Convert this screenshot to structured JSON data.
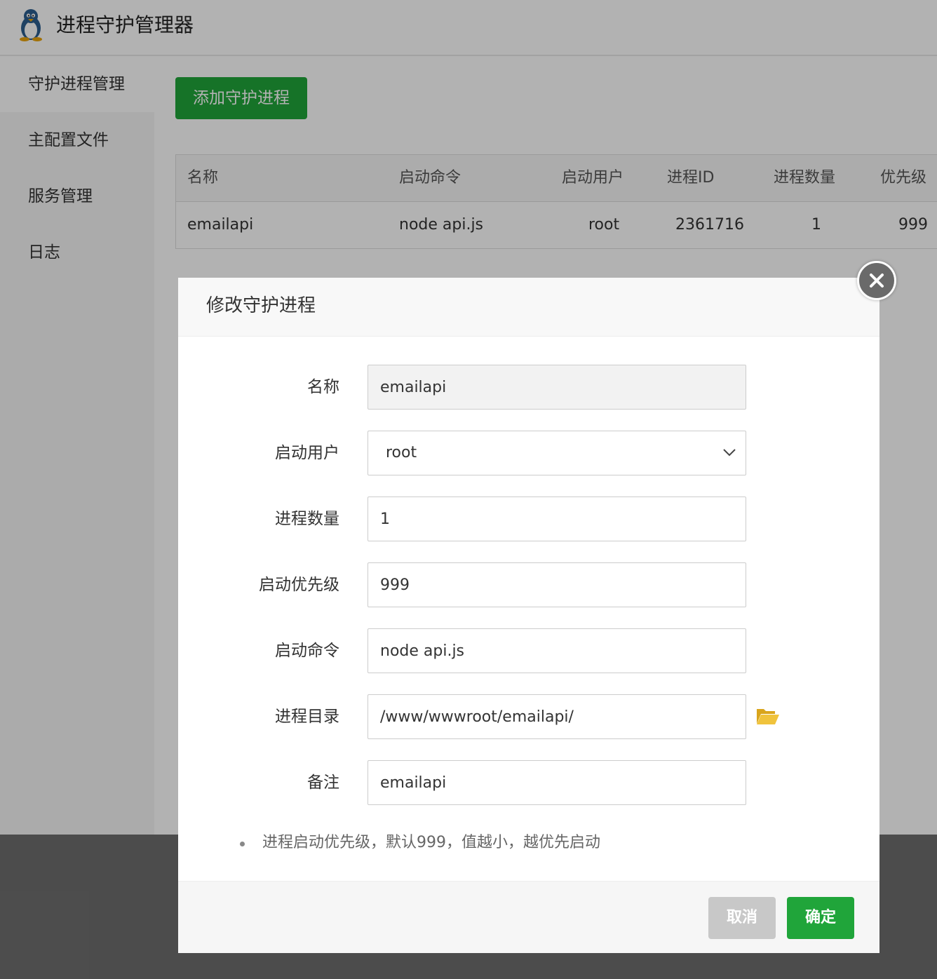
{
  "app": {
    "title": "进程守护管理器"
  },
  "sidebar": {
    "items": [
      {
        "label": "守护进程管理",
        "active": true
      },
      {
        "label": "主配置文件"
      },
      {
        "label": "服务管理"
      },
      {
        "label": "日志"
      }
    ]
  },
  "main": {
    "add_button": "添加守护进程",
    "table": {
      "headers": [
        "名称",
        "启动命令",
        "启动用户",
        "进程ID",
        "进程数量",
        "优先级"
      ],
      "rows": [
        [
          "emailapi",
          "node api.js",
          "root",
          "2361716",
          "1",
          "999"
        ]
      ]
    }
  },
  "modal": {
    "title": "修改守护进程",
    "fields": {
      "name": {
        "label": "名称",
        "value": "emailapi"
      },
      "user": {
        "label": "启动用户",
        "value": "root"
      },
      "count": {
        "label": "进程数量",
        "value": "1"
      },
      "priority": {
        "label": "启动优先级",
        "value": "999"
      },
      "command": {
        "label": "启动命令",
        "value": "node api.js"
      },
      "dir": {
        "label": "进程目录",
        "value": "/www/wwwroot/emailapi/"
      },
      "remark": {
        "label": "备注",
        "value": "emailapi"
      }
    },
    "tip": "进程启动优先级，默认999，值越小，越优先启动",
    "cancel": "取消",
    "confirm": "确定"
  },
  "colors": {
    "primary": "#20a53a",
    "cancel": "#c8c8c8",
    "folder": "#e6b422"
  }
}
